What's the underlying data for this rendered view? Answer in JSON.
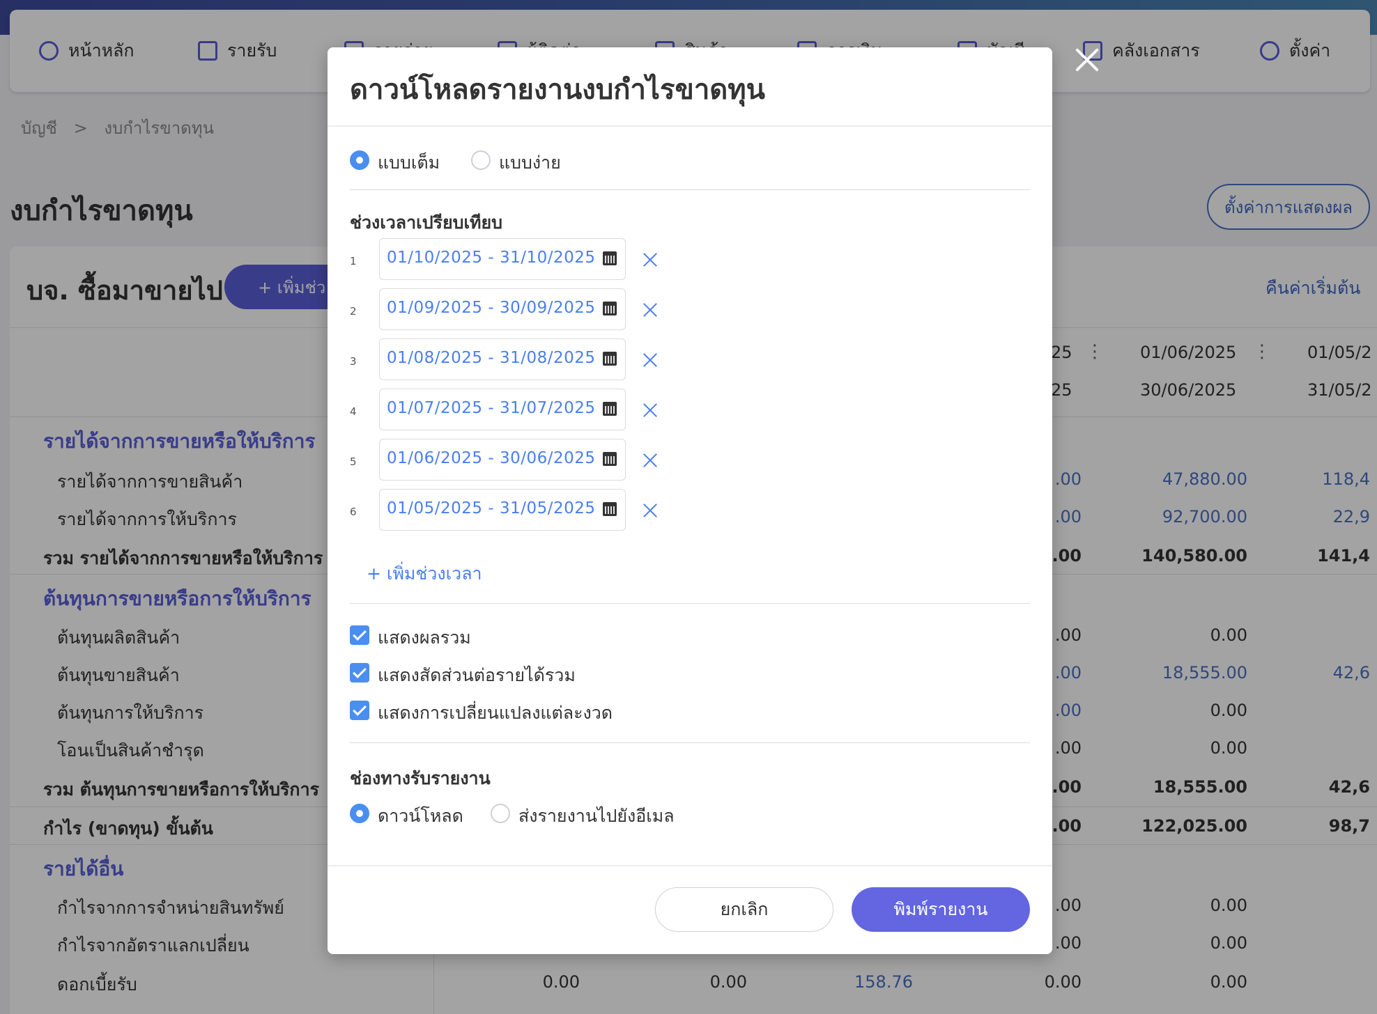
{
  "nav": {
    "items": [
      {
        "label": "หน้าหลัก",
        "icon": "dashboard-icon"
      },
      {
        "label": "รายรับ",
        "icon": "list-icon"
      },
      {
        "label": "รายจ่าย",
        "icon": "sort-icon"
      },
      {
        "label": "ผู้ติดต่อ",
        "icon": "contacts-icon"
      },
      {
        "label": "สินค้า",
        "icon": "box-icon"
      },
      {
        "label": "การเงิน",
        "icon": "wallet-icon"
      },
      {
        "label": "บัญชี",
        "icon": "book-icon"
      },
      {
        "label": "คลังเอกสาร",
        "icon": "folder-icon"
      },
      {
        "label": "ตั้งค่า",
        "icon": "gear-icon"
      }
    ]
  },
  "breadcrumb": {
    "root": "บัญชี",
    "sep": ">",
    "current": "งบกำไรขาดทุน"
  },
  "page": {
    "title": "งบกำไรขาดทุน",
    "display_settings": "ตั้งค่าการแสดงผล",
    "company": "บจ. ซื้อมาขายไป",
    "add_range": "+ เพิ่มช่ว",
    "reset": "คืนค่าเริ่มต้น"
  },
  "columns": [
    {
      "from": "25",
      "to": "25"
    },
    {
      "from": "01/06/2025",
      "to": "30/06/2025"
    },
    {
      "from": "01/05/2",
      "to": "31/05/2"
    }
  ],
  "rows": [
    {
      "label": "รายได้จากการขายหรือให้บริการ",
      "type": "section",
      "cells": [
        "",
        "",
        ""
      ]
    },
    {
      "label": "รายได้จากการขายสินค้า",
      "type": "item",
      "cells": [
        ".00",
        "47,880.00",
        "118,4"
      ]
    },
    {
      "label": "รายได้จากการให้บริการ",
      "type": "item",
      "cells": [
        ".00",
        "92,700.00",
        "22,9"
      ]
    },
    {
      "label": "รวม รายได้จากการขายหรือให้บริการ",
      "type": "total",
      "cells": [
        ".00",
        "140,580.00",
        "141,4"
      ]
    },
    {
      "label": "ต้นทุนการขายหรือการให้บริการ",
      "type": "section",
      "cells": [
        "",
        "",
        ""
      ]
    },
    {
      "label": "ต้นทุนผลิตสินค้า",
      "type": "item",
      "cells": [
        ".00",
        "0.00",
        ""
      ]
    },
    {
      "label": "ต้นทุนขายสินค้า",
      "type": "item",
      "cells": [
        ".00",
        "18,555.00",
        "42,6"
      ]
    },
    {
      "label": "ต้นทุนการให้บริการ",
      "type": "item",
      "cells": [
        ".00",
        "0.00",
        ""
      ]
    },
    {
      "label": "โอนเป็นสินค้าชำรุด",
      "type": "item",
      "cells": [
        ".00",
        "0.00",
        ""
      ]
    },
    {
      "label": "รวม ต้นทุนการขายหรือการให้บริการ",
      "type": "total",
      "cells": [
        ".00",
        "18,555.00",
        "42,6"
      ]
    },
    {
      "label": "กำไร (ขาดทุน) ขั้นต้น",
      "type": "total",
      "cells": [
        ".00",
        "122,025.00",
        "98,7"
      ]
    },
    {
      "label": "รายได้อื่น",
      "type": "section",
      "cells": [
        "",
        "",
        ""
      ]
    },
    {
      "label": "กำไรจากการจำหน่ายสินทรัพย์",
      "type": "item",
      "cells": [
        ".00",
        "0.00",
        ""
      ]
    },
    {
      "label": "กำไรจากอัตราแลกเปลี่ยน",
      "type": "item",
      "cells": [
        ".00",
        "0.00",
        ""
      ]
    },
    {
      "label": "ดอกเบี้ยรับ",
      "type": "item",
      "cells": [
        "0.00",
        "0.00",
        "158.76",
        "0.00",
        "0.00"
      ]
    }
  ],
  "modal": {
    "title": "ดาวน์โหลดรายงานงบกำไรขาดทุน",
    "format_full": "แบบเต็ม",
    "format_simple": "แบบง่าย",
    "compare_label": "ช่วงเวลาเปรียบเทียบ",
    "ranges": [
      {
        "num": "1",
        "value": "01/10/2025 - 31/10/2025"
      },
      {
        "num": "2",
        "value": "01/09/2025 - 30/09/2025"
      },
      {
        "num": "3",
        "value": "01/08/2025 - 31/08/2025"
      },
      {
        "num": "4",
        "value": "01/07/2025 - 31/07/2025"
      },
      {
        "num": "5",
        "value": "01/06/2025 - 30/06/2025"
      },
      {
        "num": "6",
        "value": "01/05/2025 - 31/05/2025"
      }
    ],
    "add_range": "+ เพิ่มช่วงเวลา",
    "options": [
      "แสดงผลรวม",
      "แสดงสัดส่วนต่อรายได้รวม",
      "แสดงการเปลี่ยนแปลงแต่ละงวด"
    ],
    "channel_label": "ช่องทางรับรายงาน",
    "channel_download": "ดาวน์โหลด",
    "channel_email": "ส่งรายงานไปยังอีเมล",
    "cancel": "ยกเลิก",
    "print": "พิมพ์รายงาน"
  },
  "colors": {
    "accent": "#5a5ed6",
    "link": "#4a7ef0",
    "primary_button": "#6366e0"
  }
}
